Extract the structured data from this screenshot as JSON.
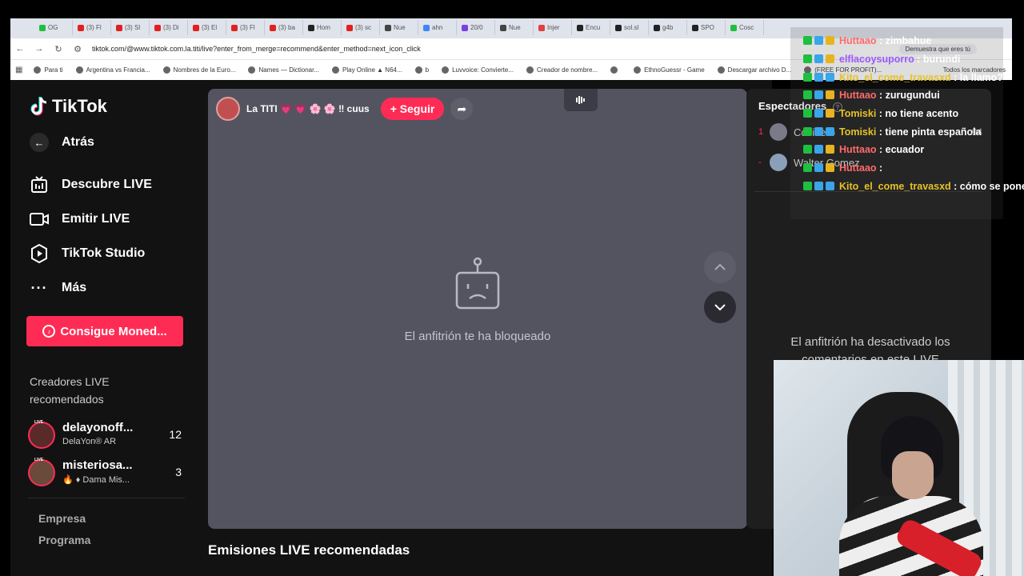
{
  "browser": {
    "tabs": [
      "OG",
      "(3) Fl",
      "(3) Sl",
      "(3) Di",
      "(3) El",
      "(3) Fl",
      "(3) ba",
      "Hom",
      "(3) sc",
      "Nue",
      "ahn",
      "20/0",
      "Nue",
      "Injer",
      "Encu",
      "sol.sl",
      "g4b",
      "SPO",
      "Cosc"
    ],
    "url": "tiktok.com/@www.tiktok.com.la.titi/live?enter_from_merge=recommend&enter_method=next_icon_click",
    "captcha_prompt": "Demuestra que eres tú",
    "bookmarks": [
      "Para ti",
      "Argentina vs Francia...",
      "Nombres de la Euro...",
      "Names — Dictionar...",
      "Play Online ▲ N64...",
      "b",
      "Luvvoice: Convierte...",
      "Creador de nombre...",
      "",
      "EthnoGuessr - Game",
      "Descargar archivo D...",
      "(FREE FOR PROFIT)..."
    ],
    "all_bookmarks": "Todos los marcadores"
  },
  "sidebar": {
    "logo": "TikTok",
    "back": "Atrás",
    "nav": [
      {
        "label": "Descubre LIVE",
        "icon": "tv-icon"
      },
      {
        "label": "Emitir LIVE",
        "icon": "camera-icon"
      },
      {
        "label": "TikTok Studio",
        "icon": "studio-icon"
      },
      {
        "label": "Más",
        "icon": "more-icon"
      }
    ],
    "coins_button": "Consigue Moned...",
    "creators_title": "Creadores LIVE recomendados",
    "creators": [
      {
        "name": "delayonoff...",
        "sub": "DelaYon® AR",
        "count": "12",
        "badge": "LIVE"
      },
      {
        "name": "misteriosa...",
        "sub": "🔥 ♦ Dama Mis...",
        "count": "3",
        "badge": "LIVE"
      }
    ],
    "footer": [
      "Empresa",
      "Programa"
    ]
  },
  "player": {
    "host_name": "La TITI 💗 💗 🌸 🌸 ‼ cuus",
    "follow": "+ Seguir",
    "blocked_message": "El anfitrión te ha bloqueado"
  },
  "recommended_title": "Emisiones LIVE recomendadas",
  "viewers": {
    "title": "Espectadores",
    "list": [
      {
        "rank": "1",
        "name": "Cocinero",
        "points": "94"
      },
      {
        "rank": "-",
        "name": "Walter Gomez  ",
        "points": ""
      }
    ],
    "comments_off": "El anfitrión ha desactivado los comentarios en este LIVE"
  },
  "chat": [
    {
      "user": "Huttaao",
      "msg": "zimbahue",
      "color": "#ff6b6b"
    },
    {
      "user": "elflacoysuporro",
      "msg": "burundi",
      "color": "#9b59ff"
    },
    {
      "user": "Kito_el_come_travasxd",
      "msg": "la llamo?",
      "color": "#e6c229"
    },
    {
      "user": "Huttaao",
      "msg": "zurugundui",
      "color": "#ff6b6b"
    },
    {
      "user": "Tomiski",
      "msg": "no tiene acento",
      "color": "#e6c229"
    },
    {
      "user": "Tomiski",
      "msg": "tiene pinta española",
      "color": "#e6c229"
    },
    {
      "user": "Huttaao",
      "msg": "ecuador",
      "color": "#ff6b6b"
    },
    {
      "user": "Huttaao",
      "msg": "",
      "color": "#ff6b6b"
    },
    {
      "user": "Kito_el_come_travasxd",
      "msg": "cómo se pone un",
      "color": "#e6c229"
    }
  ]
}
